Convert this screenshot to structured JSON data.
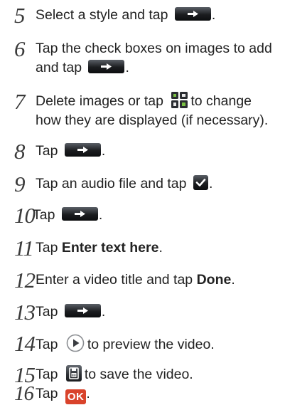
{
  "steps": [
    {
      "number": "5",
      "text_before": "Select a style and tap",
      "text_after": "."
    },
    {
      "number": "6",
      "text_line1": "Tap the check boxes on images to add",
      "text_before": "and tap",
      "text_after": "."
    },
    {
      "number": "7",
      "text_before": "Delete images or tap",
      "text_after": "to change",
      "text_line2": "how they are displayed (if necessary)."
    },
    {
      "number": "8",
      "text_before": "Tap",
      "text_after": "."
    },
    {
      "number": "9",
      "text_before": "Tap an audio file and tap",
      "text_after": "."
    },
    {
      "number": "10",
      "text_before": "Tap",
      "text_after": "."
    },
    {
      "number": "11",
      "text_before": "Tap",
      "bold": "Enter text here",
      "text_after": "."
    },
    {
      "number": "12",
      "text_before": "Enter a video title and tap",
      "bold": "Done",
      "text_after": "."
    },
    {
      "number": "13",
      "text_before": "Tap",
      "text_after": "."
    },
    {
      "number": "14",
      "text_before": "Tap",
      "text_after": "to preview the video."
    },
    {
      "number": "15",
      "text_before": "Tap",
      "text_after": "to save the video."
    },
    {
      "number": "16",
      "text_before": "Tap",
      "ok_label": "OK",
      "text_after": "."
    }
  ],
  "icons": {
    "next": "right-arrow-icon",
    "confirm": "checkmark-icon",
    "view": "grid-view-icon",
    "play": "play-icon",
    "save": "save-icon",
    "ok": "ok-button"
  },
  "colors": {
    "text": "#222222",
    "button_dark": "#1b1d20",
    "ok_red": "#d9432b"
  }
}
